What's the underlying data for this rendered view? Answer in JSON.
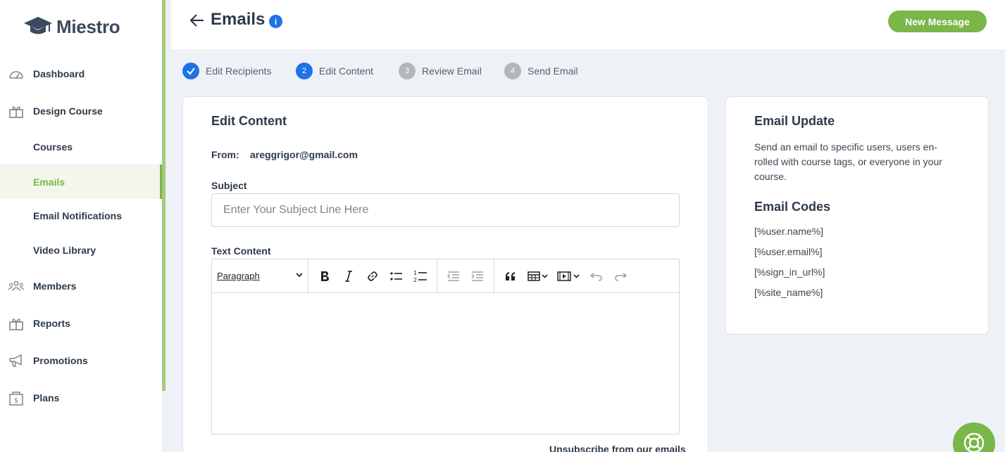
{
  "brand": {
    "name": "Miestro",
    "accent": "#7ab648",
    "link_blue": "#1f73e6"
  },
  "sidebar": {
    "items": [
      {
        "label": "Dashboard",
        "icon": "dashboard-gauge-icon"
      },
      {
        "label": "Design Course",
        "icon": "course-box-icon"
      },
      {
        "label": "Courses"
      },
      {
        "label": "Emails",
        "active": true
      },
      {
        "label": "Email Notifications"
      },
      {
        "label": "Video Library"
      },
      {
        "label": "Members",
        "icon": "members-group-icon"
      },
      {
        "label": "Reports",
        "icon": "reports-box-icon"
      },
      {
        "label": "Promotions",
        "icon": "megaphone-icon"
      },
      {
        "label": "Plans",
        "icon": "plans-dollar-icon"
      }
    ]
  },
  "header": {
    "title": "Emails",
    "new_message_label": "New Message"
  },
  "steps": [
    {
      "number": "1",
      "label": "Edit Recipients",
      "state": "done"
    },
    {
      "number": "2",
      "label": "Edit Content",
      "state": "current"
    },
    {
      "number": "3",
      "label": "Review Email",
      "state": "todo"
    },
    {
      "number": "4",
      "label": "Send Email",
      "state": "todo"
    }
  ],
  "main": {
    "title": "Edit Content",
    "from_label": "From:",
    "from_value": "areggrigor@gmail.com",
    "subject_label": "Subject",
    "subject_placeholder": "Enter Your Subject Line Here",
    "subject_value": "",
    "text_content_label": "Text Content",
    "editor": {
      "block_format": "Paragraph",
      "tools": [
        "bold",
        "italic",
        "link",
        "bulleted-list",
        "numbered-list",
        "outdent",
        "indent",
        "blockquote",
        "table",
        "media",
        "undo",
        "redo"
      ]
    },
    "unsubscribe_label": "Unsubscribe from our emails"
  },
  "side": {
    "title": "Email Update",
    "description_lines": [
      "Send an email to specific users, users en-",
      "rolled with course tags, or everyone in your",
      "course."
    ],
    "codes_title": "Email Codes",
    "codes": [
      "[%user.name%]",
      "[%user.email%]",
      "[%sign_in_url%]",
      "[%site_name%]"
    ]
  }
}
